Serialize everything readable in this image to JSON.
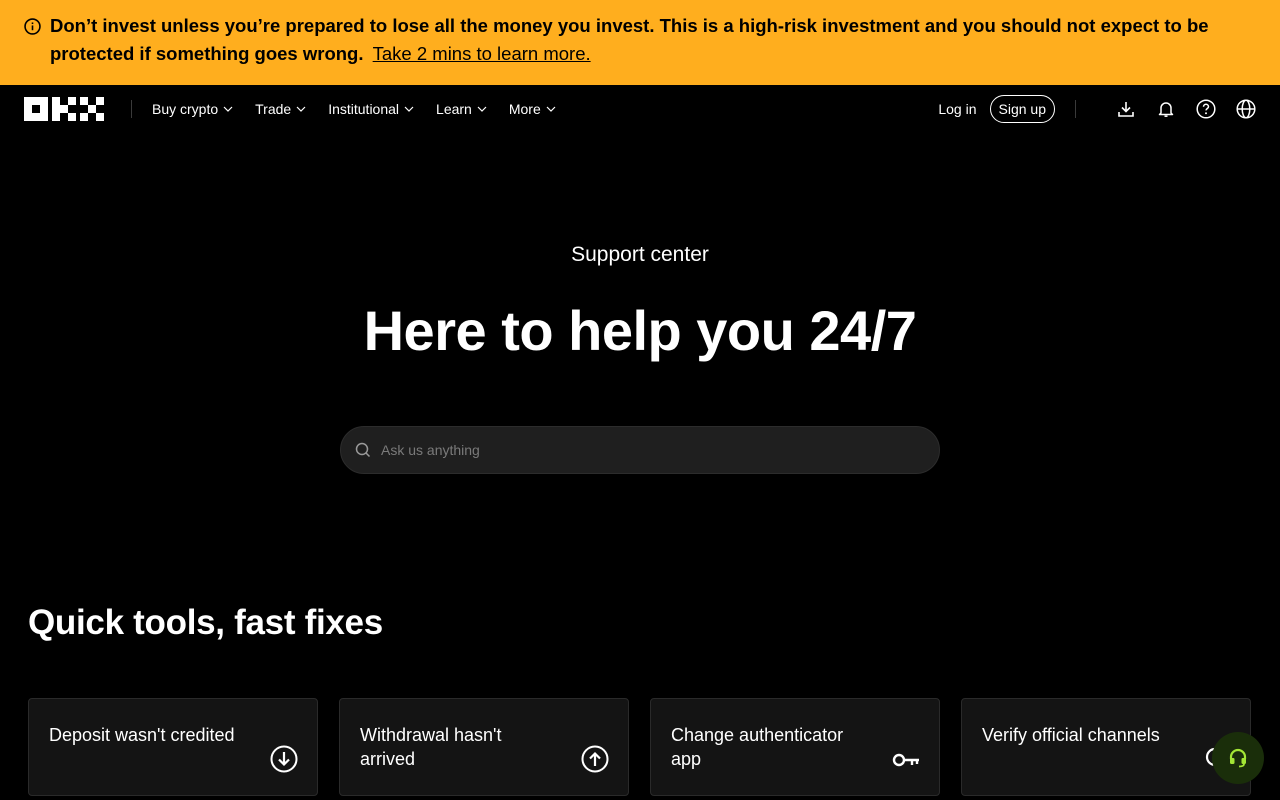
{
  "banner": {
    "warning_text": "Don’t invest unless you’re prepared to lose all the money you invest. This is a high-risk investment and you should not expect to be protected if something goes wrong.",
    "link_text": "Take 2 mins to learn more."
  },
  "nav": {
    "items": [
      {
        "label": "Buy crypto"
      },
      {
        "label": "Trade"
      },
      {
        "label": "Institutional"
      },
      {
        "label": "Learn"
      },
      {
        "label": "More"
      }
    ],
    "login_label": "Log in",
    "signup_label": "Sign up"
  },
  "hero": {
    "subtitle": "Support center",
    "title": "Here to help you 24/7"
  },
  "search": {
    "placeholder": "Ask us anything"
  },
  "quick_tools": {
    "title": "Quick tools, fast fixes",
    "cards": [
      {
        "label": "Deposit wasn't credited",
        "icon": "download-circle-icon"
      },
      {
        "label": "Withdrawal hasn't arrived",
        "icon": "upload-circle-icon"
      },
      {
        "label": "Change authenticator app",
        "icon": "key-icon"
      },
      {
        "label": "Verify official channels",
        "icon": "verify-icon"
      }
    ]
  },
  "colors": {
    "banner_bg": "#ffae1e",
    "page_bg": "#000000",
    "card_bg": "#141414",
    "support_accent": "#a3e635"
  }
}
